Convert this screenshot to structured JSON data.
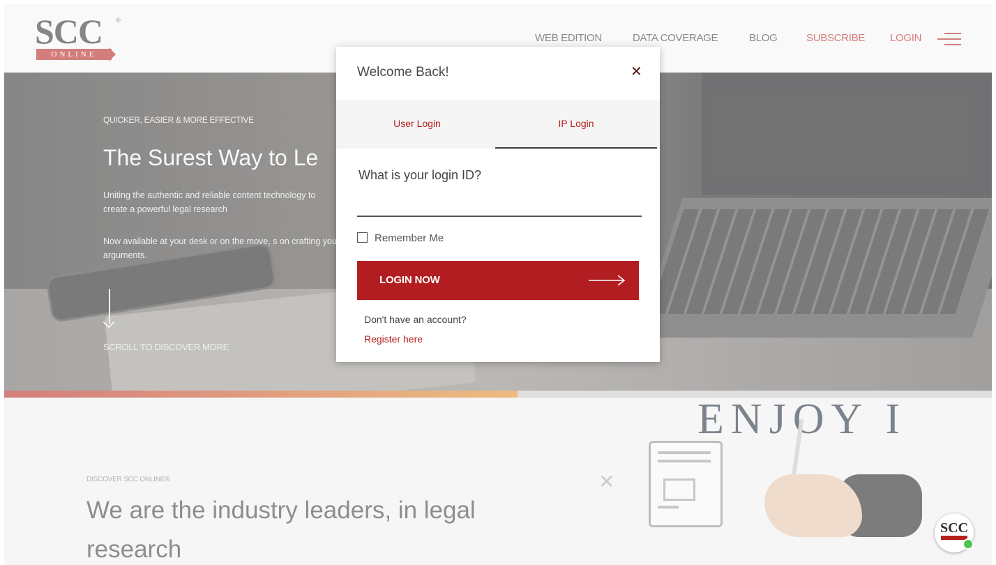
{
  "header": {
    "logo_text": "SCC",
    "logo_band": "ONLINE",
    "nav": [
      {
        "label": "WEB EDITION"
      },
      {
        "label": "DATA COVERAGE"
      },
      {
        "label": "BLOG"
      },
      {
        "label": "SUBSCRIBE",
        "color": "#b4211f"
      },
      {
        "label": "LOGIN",
        "color": "#b4211f"
      }
    ],
    "menu_icon": "hamburger-menu-icon"
  },
  "hero": {
    "tagline": "QUICKER, EASIER & MORE EFFECTIVE",
    "title": "The Surest Way to Le",
    "description": "Uniting the authentic and reliable content technology to create a powerful legal research",
    "description2": "Now available at your desk or on the move, s on crafting your arguments.",
    "scroll_text": "SCROLL TO DISCOVER MORE",
    "slide_progress": 0.52
  },
  "discover": {
    "label": "DISCOVER SCC ONLINE®",
    "title": "We are the industry leaders, in legal research"
  },
  "banner": {
    "headline": "ENJOY I"
  },
  "modal": {
    "title": "Welcome Back!",
    "close_symbol": "✕",
    "tabs": [
      {
        "label": "User Login",
        "active": false
      },
      {
        "label": "IP Login",
        "active": true
      }
    ],
    "login_id_label": "What is your login ID?",
    "login_id_value": "",
    "remember_label": "Remember Me",
    "remember_checked": false,
    "submit_label": "LOGIN NOW",
    "no_account_text": "Don't have an account?",
    "register_link": "Register here"
  },
  "chat_badge": {
    "text": "SCC",
    "status": "online"
  },
  "colors": {
    "brand_red": "#b4211f",
    "button_red": "#b11d20",
    "online_green": "#4fc34f"
  }
}
